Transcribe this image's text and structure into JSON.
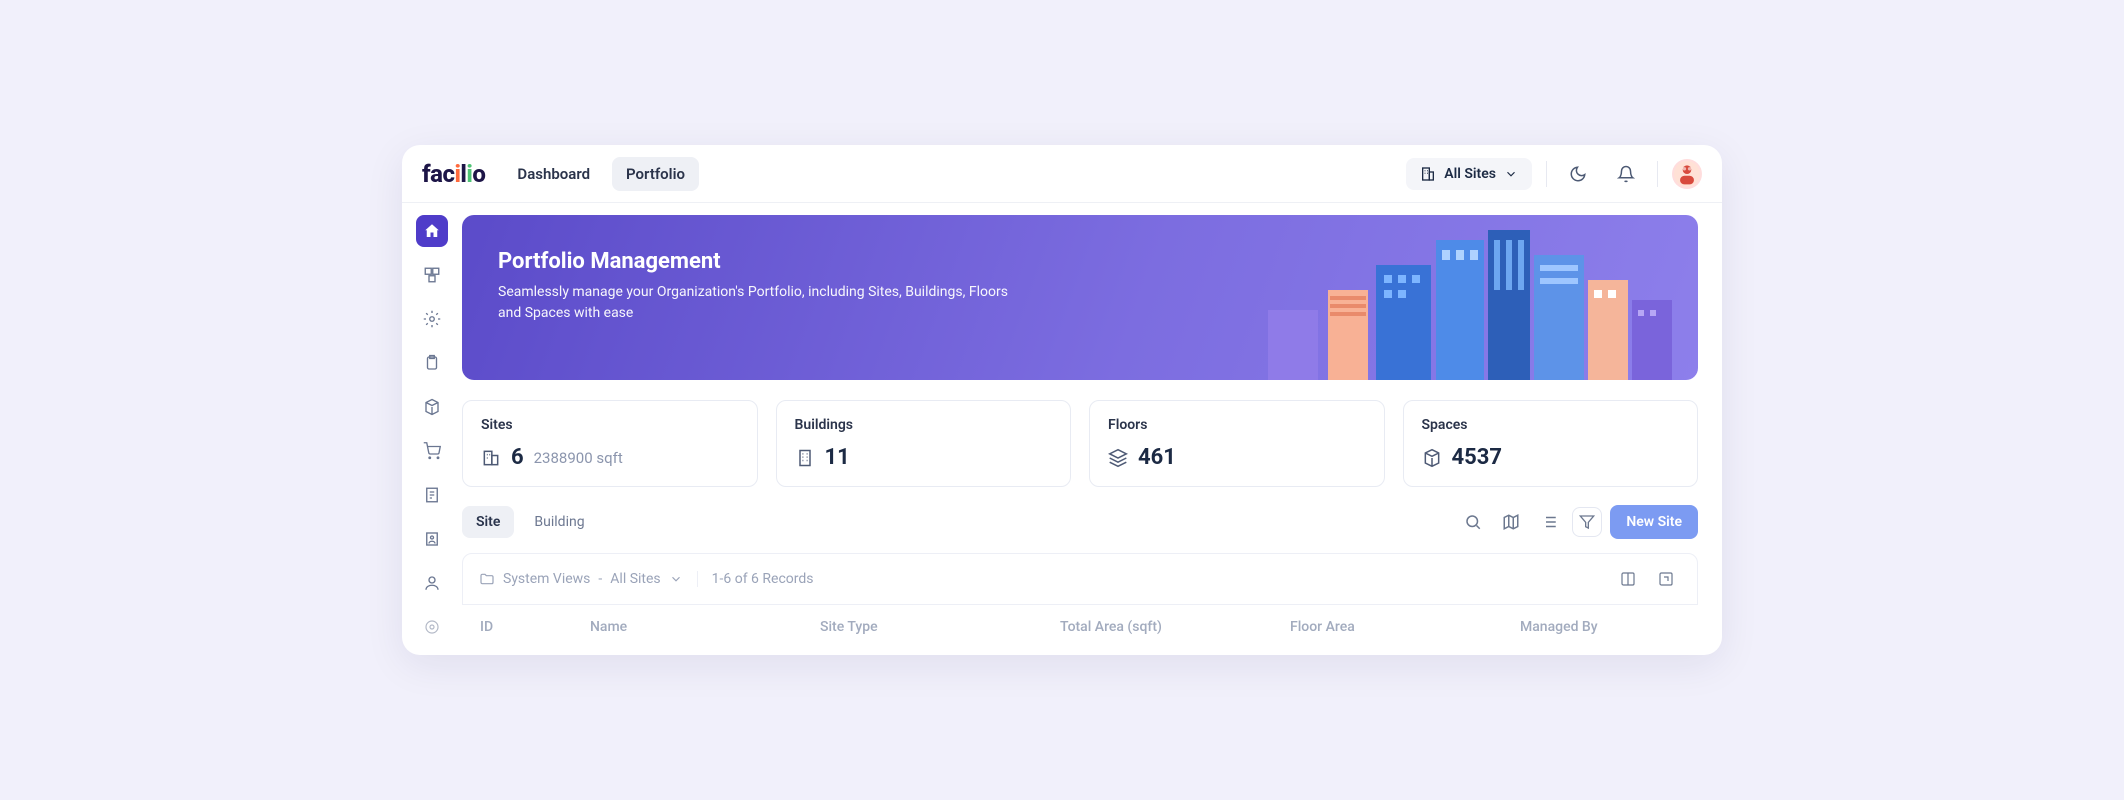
{
  "logo": {
    "text": "facilio"
  },
  "nav": {
    "dashboard": "Dashboard",
    "portfolio": "Portfolio"
  },
  "sitePicker": {
    "label": "All Sites"
  },
  "hero": {
    "title": "Portfolio Management",
    "desc": "Seamlessly manage your Organization's Portfolio, including Sites, Buildings, Floors and Spaces with ease"
  },
  "stats": {
    "sites": {
      "label": "Sites",
      "value": "6",
      "sub": "2388900 sqft"
    },
    "buildings": {
      "label": "Buildings",
      "value": "11"
    },
    "floors": {
      "label": "Floors",
      "value": "461"
    },
    "spaces": {
      "label": "Spaces",
      "value": "4537"
    }
  },
  "subtabs": {
    "site": "Site",
    "building": "Building"
  },
  "newButton": "New Site",
  "viewBar": {
    "views": "System Views",
    "current": "All Sites",
    "records": "1-6 of 6 Records"
  },
  "columns": {
    "id": "ID",
    "name": "Name",
    "type": "Site Type",
    "area": "Total Area (sqft)",
    "floor": "Floor Area",
    "managed": "Managed By"
  }
}
